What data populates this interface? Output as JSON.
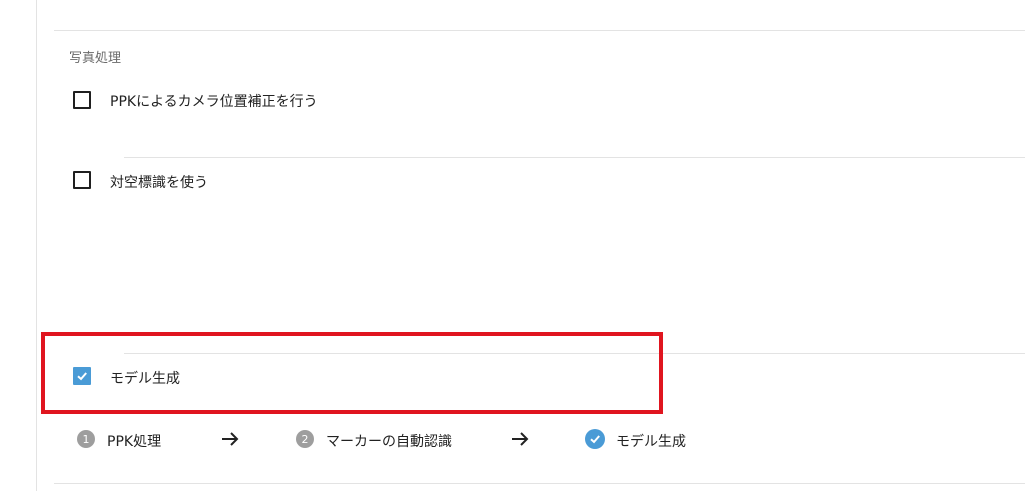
{
  "section": {
    "title": "写真処理"
  },
  "options": [
    {
      "label": "PPKによるカメラ位置補正を行う",
      "checked": false
    },
    {
      "label": "対空標識を使う",
      "checked": false
    },
    {
      "label": "モデル生成",
      "checked": true
    }
  ],
  "steps": [
    {
      "number": "1",
      "label": "PPK処理",
      "status": "pending"
    },
    {
      "number": "2",
      "label": "マーカーの自動認識",
      "status": "pending"
    },
    {
      "number": "",
      "label": "モデル生成",
      "status": "done"
    }
  ],
  "colors": {
    "accent": "#4a9bd6",
    "highlight": "#e0151f",
    "step_pending": "#9e9e9e"
  },
  "icons": {
    "arrow": "arrow-right-icon",
    "check": "check-icon"
  }
}
